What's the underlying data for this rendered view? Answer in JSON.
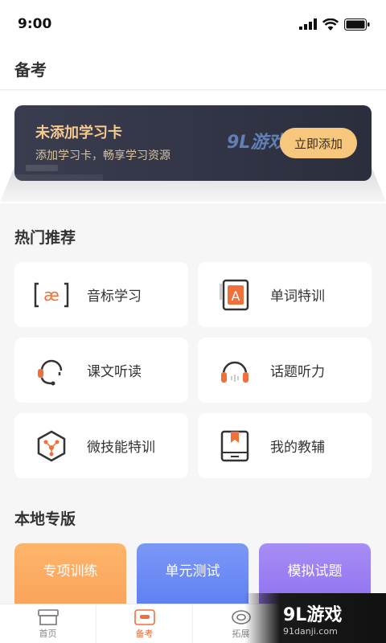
{
  "status_bar": {
    "time": "9:00"
  },
  "header": {
    "title": "备考"
  },
  "banner": {
    "title": "未添加学习卡",
    "subtitle": "添加学习卡，畅享学习资源",
    "button_label": "立即添加",
    "watermark": "9L游戏"
  },
  "hot": {
    "title": "热门推荐",
    "items": [
      {
        "label": "音标学习",
        "icon": "phonetic-icon"
      },
      {
        "label": "单词特训",
        "icon": "word-book-icon"
      },
      {
        "label": "课文听读",
        "icon": "headset-mic-icon"
      },
      {
        "label": "话题听力",
        "icon": "headphones-icon"
      },
      {
        "label": "微技能特训",
        "icon": "hexagon-skill-icon"
      },
      {
        "label": "我的教辅",
        "icon": "book-icon"
      }
    ]
  },
  "local": {
    "title": "本地专版",
    "items": [
      {
        "label": "专项训练",
        "color": "#fcaa5a"
      },
      {
        "label": "单元测试",
        "color": "#6b8cf5"
      },
      {
        "label": "模拟试题",
        "color": "#9b7df2"
      }
    ]
  },
  "tabbar": {
    "tabs": [
      {
        "label": "首页",
        "active": false
      },
      {
        "label": "备考",
        "active": true
      },
      {
        "label": "拓展",
        "active": false
      }
    ]
  },
  "watermark": {
    "main": "9L游戏",
    "sub": "91danji.com"
  },
  "colors": {
    "accent": "#f0703c",
    "banner_bg": "#2f3242",
    "banner_button": "#f7c77e"
  }
}
